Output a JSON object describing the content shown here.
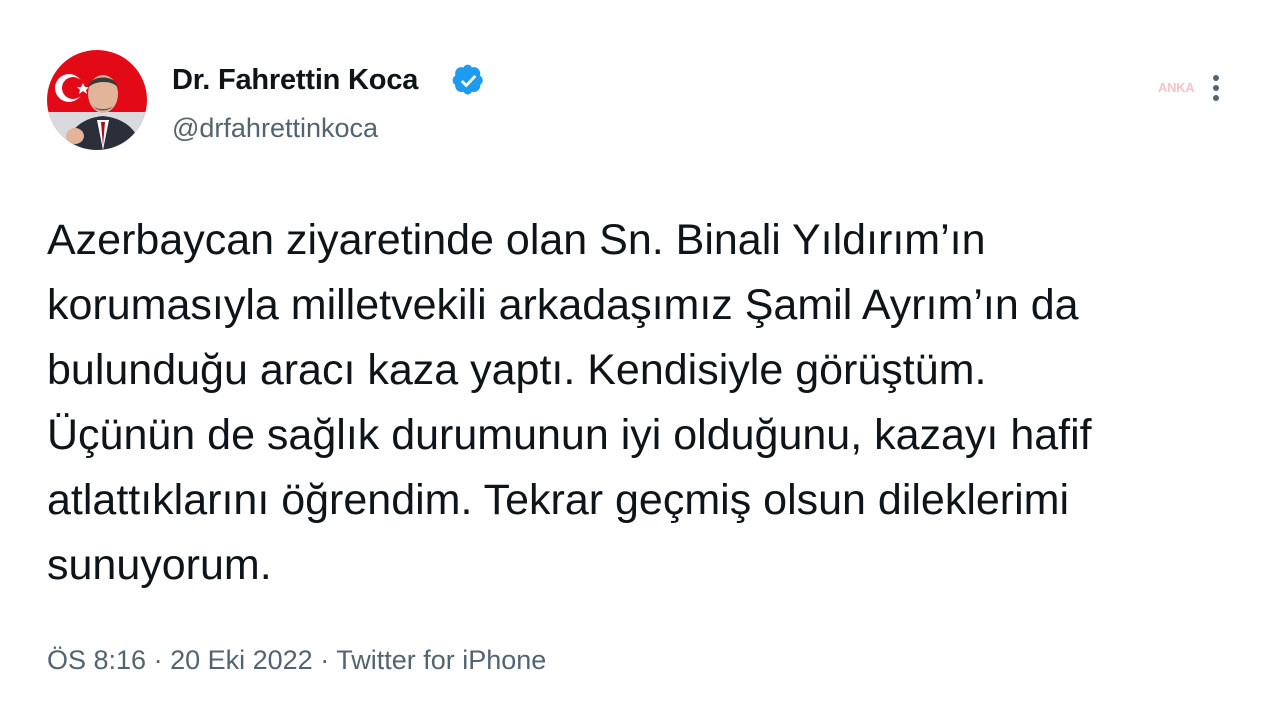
{
  "tweet": {
    "author": {
      "display_name": "Dr. Fahrettin Koca",
      "handle": "@drfahrettinkoca",
      "verified_icon": "verified-badge-icon"
    },
    "watermark": "ANKA",
    "text_lines": [
      "Azerbaycan ziyaretinde olan Sn. Binali Yıldırım’ın",
      "korumasıyla milletvekili arkadaşımız Şamil Ayrım’ın da",
      "bulunduğu aracı kaza yaptı. Kendisiyle görüştüm.",
      "Üçünün de sağlık durumunun iyi olduğunu, kazayı hafif",
      "atlattıklarını öğrendim. Tekrar geçmiş olsun dileklerimi",
      "sunuyorum."
    ],
    "meta": {
      "time": "ÖS 8:16",
      "separator": "·",
      "date": "20 Eki 2022",
      "source": "Twitter for iPhone"
    }
  },
  "colors": {
    "text": "#0f1419",
    "secondary": "#536471",
    "verified": "#1d9bf0",
    "avatar_flag": "#e30a17"
  }
}
